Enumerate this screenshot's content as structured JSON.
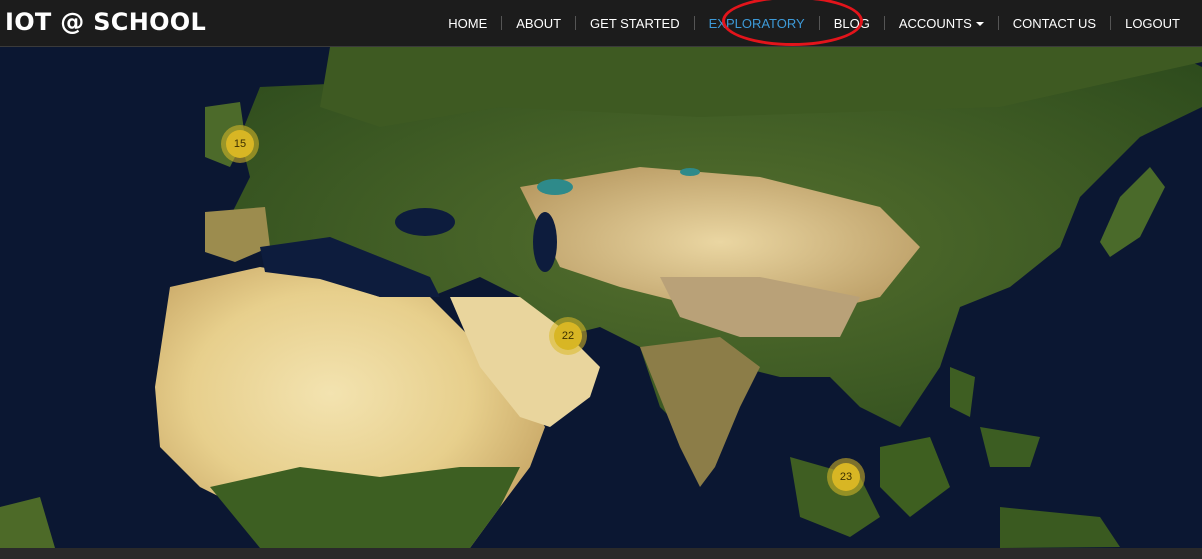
{
  "brand": {
    "title": "IOT @ SCHOOL"
  },
  "nav": {
    "items": [
      {
        "label": "HOME",
        "name": "nav-home"
      },
      {
        "label": "ABOUT",
        "name": "nav-about"
      },
      {
        "label": "GET STARTED",
        "name": "nav-get-started"
      },
      {
        "label": "EXPLORATORY",
        "name": "nav-exploratory",
        "active": true
      },
      {
        "label": "BLOG",
        "name": "nav-blog"
      },
      {
        "label": "ACCOUNTS",
        "name": "nav-accounts",
        "dropdown": true
      },
      {
        "label": "CONTACT US",
        "name": "nav-contact-us"
      },
      {
        "label": "LOGOUT",
        "name": "nav-logout"
      }
    ],
    "highlight": {
      "item": "EXPLORATORY",
      "color": "#e3141b"
    }
  },
  "map": {
    "type": "satellite",
    "clusters": [
      {
        "count": "15",
        "region": "Western Europe"
      },
      {
        "count": "22",
        "region": "Arabian Peninsula"
      },
      {
        "count": "23",
        "region": "Southeast Asia"
      }
    ]
  },
  "colors": {
    "navbar": "#1c1c1c",
    "active_link": "#3d9ad8",
    "cluster": "#d8b624",
    "ocean": "#0b1732"
  }
}
